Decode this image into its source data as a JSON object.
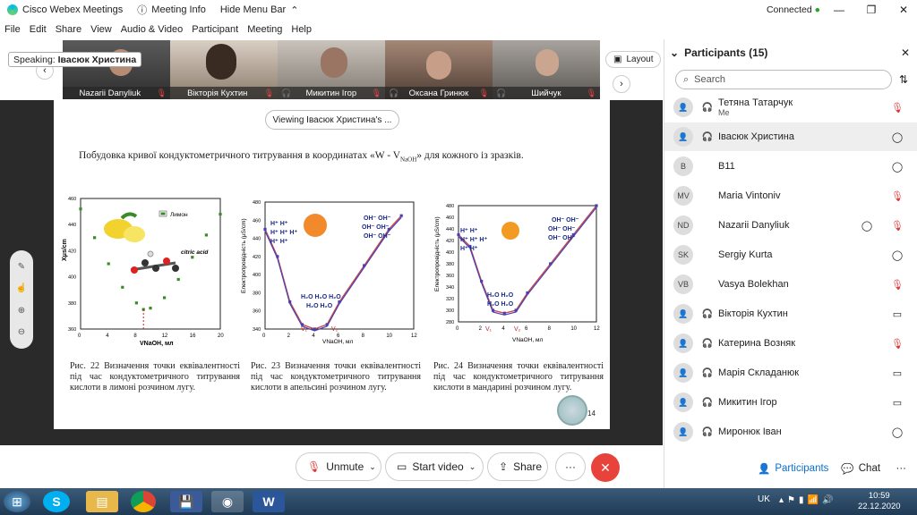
{
  "window": {
    "title": "Cisco Webex Meetings",
    "meeting_info": "Meeting Info",
    "hide_menu": "Hide Menu Bar",
    "status": "Connected"
  },
  "menu": [
    "File",
    "Edit",
    "Share",
    "View",
    "Audio & Video",
    "Participant",
    "Meeting",
    "Help"
  ],
  "speaking": {
    "label": "Speaking:",
    "name": "Івасюк Христина"
  },
  "layout_label": "Layout",
  "videos": [
    {
      "name": "Nazarii Danyliuk",
      "mic": "muted"
    },
    {
      "name": "Вікторія Кухтин",
      "mic": "muted"
    },
    {
      "name": "Микитин Ігор",
      "mic": "muted"
    },
    {
      "name": "Оксана Гринюк",
      "mic": "muted"
    },
    {
      "name": "Шийчук",
      "mic": "muted"
    }
  ],
  "viewing": "Viewing Івасюк Христина's ...",
  "slide": {
    "heading": "Побудовка кривої кондуктометричного титрування в координатах «W - V",
    "heading_sub": "NaOH",
    "heading_tail": "» для кожного із зразків.",
    "captions": [
      "Рис. 22 Визначення точки еквівалентності під час кондуктометричного титрування кислоти в лимоні розчином лугу.",
      "Рис. 23 Визначення точки еквівалентності під час кондуктометричного титрування кислоти в апельсині розчином лугу.",
      "Рис. 24 Визначення точки еквівалентності під час кондуктометричного титрування кислоти в мандарині розчином лугу."
    ],
    "page": "14"
  },
  "chart_data": [
    {
      "type": "scatter",
      "series": [
        {
          "name": "Лимон",
          "values": [
            [
              0,
              452
            ],
            [
              2,
              430
            ],
            [
              4,
              410
            ],
            [
              6,
              392
            ],
            [
              8,
              380
            ],
            [
              9,
              375
            ],
            [
              10,
              376
            ],
            [
              12,
              384
            ],
            [
              14,
              398
            ],
            [
              16,
              415
            ],
            [
              18,
              432
            ],
            [
              20,
              448
            ]
          ]
        }
      ],
      "xlabel": "VNaOH, мл",
      "ylabel": "Xμs/cm",
      "xlim": [
        0,
        20
      ],
      "ylim": [
        360,
        460
      ],
      "xticks": [
        "0",
        "4",
        "8",
        "12",
        "16",
        "20"
      ],
      "yticks": [
        "360",
        "380",
        "400",
        "420",
        "440",
        "460"
      ],
      "annotations": [
        "citric acid",
        "Veq"
      ]
    },
    {
      "type": "line",
      "series": [
        {
          "name": "",
          "values": [
            [
              0,
              450
            ],
            [
              1,
              420
            ],
            [
              2,
              370
            ],
            [
              3,
              345
            ],
            [
              4,
              340
            ],
            [
              5,
              345
            ],
            [
              6,
              370
            ],
            [
              8,
              410
            ],
            [
              10,
              450
            ],
            [
              11,
              465
            ]
          ]
        }
      ],
      "xlabel": "VNaOH, мл",
      "ylabel": "Електропровідність (μS/cm)",
      "xlim": [
        0,
        12
      ],
      "ylim": [
        340,
        480
      ],
      "xticks": [
        "0",
        "2",
        "4",
        "6",
        "8",
        "10",
        "12"
      ],
      "yticks": [
        "340",
        "360",
        "380",
        "400",
        "420",
        "440",
        "460",
        "480"
      ],
      "annotations": [
        "V1",
        "V2",
        "H+",
        "OH-",
        "H2O"
      ]
    },
    {
      "type": "line",
      "series": [
        {
          "name": "",
          "values": [
            [
              0,
              430
            ],
            [
              1,
              410
            ],
            [
              2,
              350
            ],
            [
              3,
              300
            ],
            [
              4,
              295
            ],
            [
              5,
              300
            ],
            [
              6,
              330
            ],
            [
              8,
              380
            ],
            [
              10,
              430
            ],
            [
              12,
              480
            ]
          ]
        }
      ],
      "xlabel": "VNaOH, мл",
      "ylabel": "Електропровідність (μS/cm)",
      "xlim": [
        0,
        12
      ],
      "ylim": [
        280,
        480
      ],
      "xticks": [
        "0",
        "2",
        "4",
        "6",
        "8",
        "10",
        "12"
      ],
      "yticks": [
        "280",
        "300",
        "320",
        "340",
        "360",
        "380",
        "400",
        "420",
        "440",
        "460",
        "480"
      ],
      "annotations": [
        "V1",
        "V2",
        "H+",
        "OH-",
        "H2O"
      ]
    }
  ],
  "controls": {
    "unmute": "Unmute",
    "start_video": "Start video",
    "share": "Share"
  },
  "participants": {
    "title": "Participants (15)",
    "search_placeholder": "Search",
    "list": [
      {
        "name": "Тетяна Татарчук",
        "note": "Me",
        "avatar": "",
        "right": "muted"
      },
      {
        "name": "Івасюк Христина",
        "note": "",
        "avatar": "",
        "right": "chat",
        "selected": true
      },
      {
        "name": "B11",
        "note": "",
        "avatar": "B",
        "right": "chat"
      },
      {
        "name": "Maria Vintoniv",
        "note": "",
        "avatar": "MV",
        "right": "muted"
      },
      {
        "name": "Nazarii Danyliuk",
        "note": "",
        "avatar": "ND",
        "right": "chat-muted"
      },
      {
        "name": "Sergiy Kurta",
        "note": "",
        "avatar": "SK",
        "right": "chat"
      },
      {
        "name": "Vasya Bolekhan",
        "note": "",
        "avatar": "VB",
        "right": "muted"
      },
      {
        "name": "Вікторія Кухтин",
        "note": "",
        "avatar": "",
        "right": "video"
      },
      {
        "name": "Катерина Возняк",
        "note": "",
        "avatar": "",
        "right": "muted"
      },
      {
        "name": "Марія Складанюк",
        "note": "",
        "avatar": "",
        "right": "video"
      },
      {
        "name": "Микитин Ігор",
        "note": "",
        "avatar": "",
        "right": "video"
      },
      {
        "name": "Миронюк Іван",
        "note": "",
        "avatar": "",
        "right": "chat"
      }
    ],
    "tab_participants": "Participants",
    "tab_chat": "Chat"
  },
  "taskbar": {
    "lang": "UK",
    "time": "10:59",
    "date": "22.12.2020"
  }
}
